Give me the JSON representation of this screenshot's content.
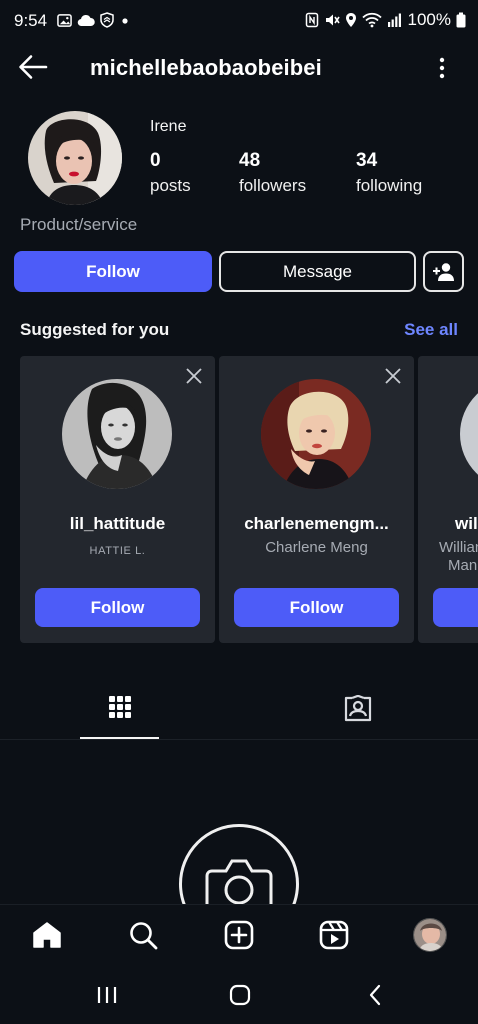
{
  "status_bar": {
    "time": "9:54",
    "battery_text": "100%",
    "icons": [
      "image-icon",
      "cloud-icon",
      "shield-icon",
      "dot-icon",
      "nfc-icon",
      "mute-icon",
      "location-icon",
      "wifi-icon",
      "signal-icon",
      "battery-icon"
    ]
  },
  "header": {
    "username": "michellebaobaobeibei",
    "back_icon": "arrow-left-icon",
    "menu_icon": "more-vertical-icon"
  },
  "profile": {
    "display_name": "Irene",
    "posts_count": "0",
    "posts_label": "posts",
    "followers_count": "48",
    "followers_label": "followers",
    "following_count": "34",
    "following_label": "following",
    "category": "Product/service"
  },
  "actions": {
    "follow_label": "Follow",
    "message_label": "Message",
    "add_user_icon": "person-add-icon"
  },
  "suggested": {
    "title": "Suggested for you",
    "see_all": "See all",
    "cards": [
      {
        "username": "lil_hattitude",
        "subtitle": "HATTIE L.",
        "button": "Follow"
      },
      {
        "username": "charlenemengm...",
        "subtitle": "Charlene Meng",
        "button": "Follow"
      },
      {
        "username": "wil",
        "subtitle_line1": "Willian",
        "subtitle_line2": "Man",
        "button": ""
      }
    ]
  },
  "tabs": {
    "grid_icon": "grid-icon",
    "tagged_icon": "tagged-person-icon",
    "active": "grid"
  },
  "bottom_nav": {
    "items": [
      "home-icon",
      "search-icon",
      "create-icon",
      "reels-icon",
      "profile-avatar"
    ],
    "active": "home"
  },
  "android_nav": {
    "items": [
      "recents-icon",
      "home-circle-icon",
      "back-chevron-icon"
    ]
  },
  "colors": {
    "background": "#0c1016",
    "card": "#23272e",
    "primary_button": "#4d5cf8",
    "link": "#6e86ff",
    "secondary_text": "#a6abb3"
  }
}
